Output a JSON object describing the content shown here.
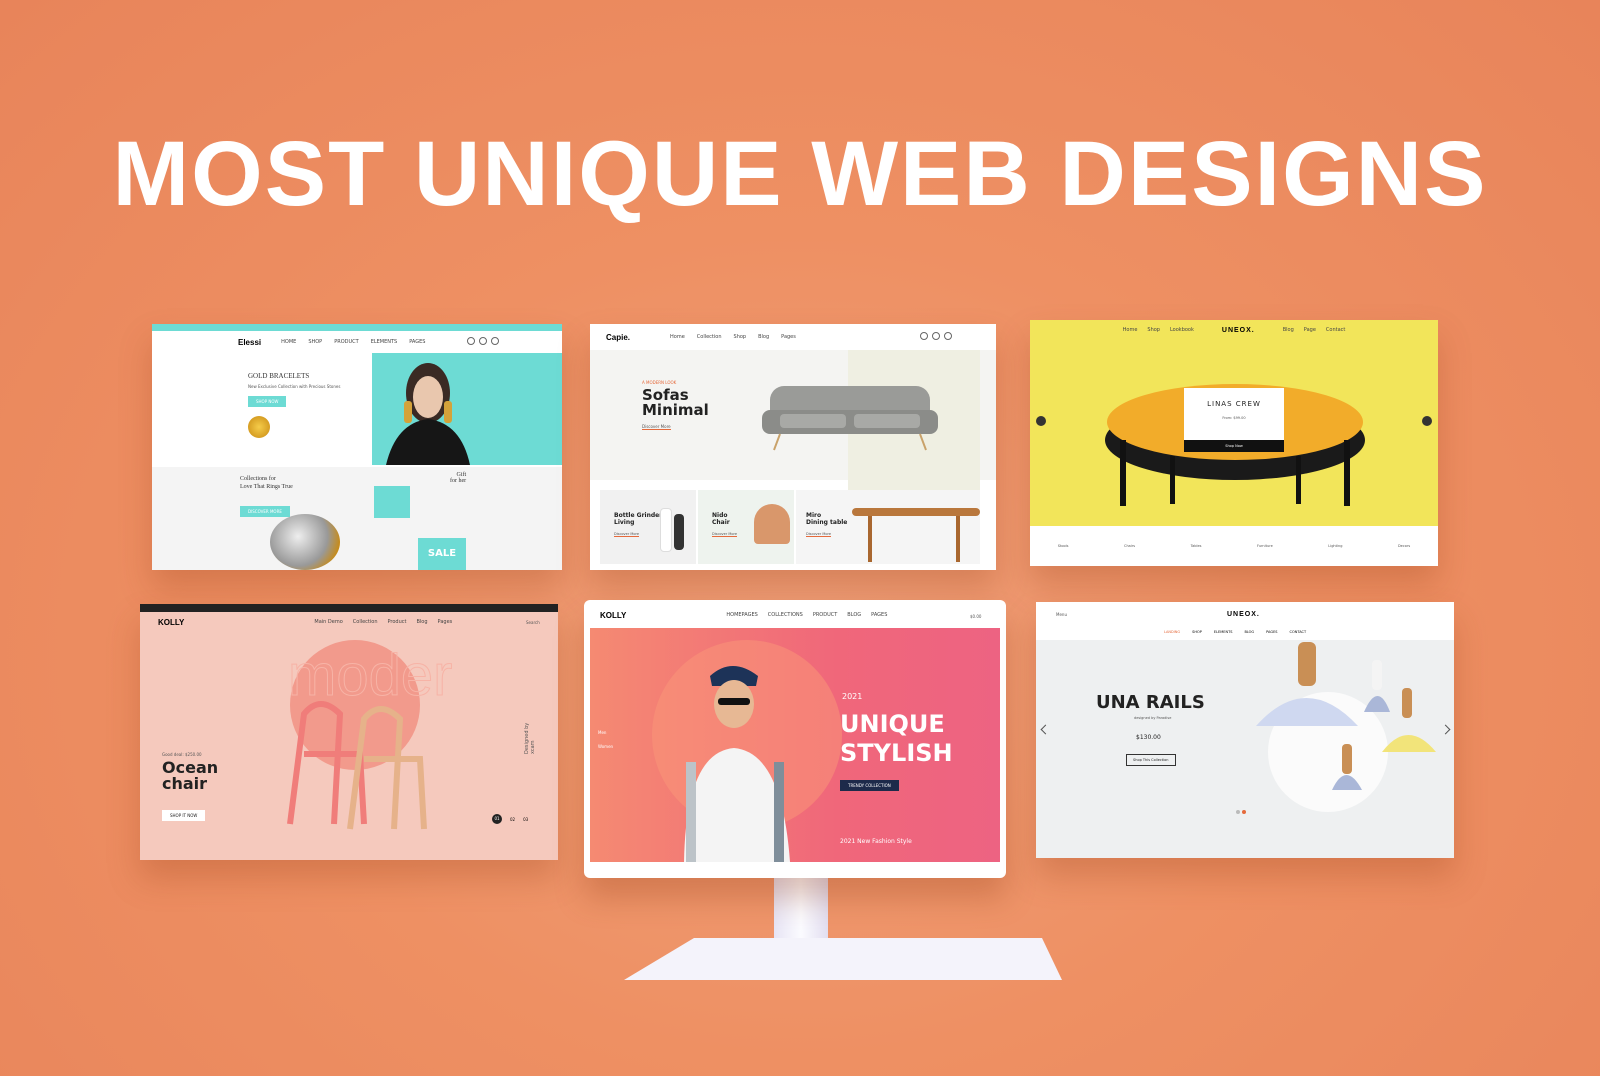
{
  "headline": "MOST UNIQUE WEB DESIGNS",
  "colors": {
    "background": "#ee9063",
    "teal": "#6ddbd4",
    "yellow": "#f2e55a",
    "pink": "#f5c9bd",
    "coral": "#f36f6f",
    "navy": "#1d2a4a"
  },
  "shot1": {
    "logo": "Elessi",
    "nav": [
      "HOME",
      "SHOP",
      "PRODUCT",
      "ELEMENTS",
      "PAGES"
    ],
    "hero_title": "GOLD BRACELETS",
    "hero_sub": "New Exclusive Collection with Precious Stones",
    "hero_btn": "SHOP NOW",
    "promo_title": "Collections for\nLove That Rings True",
    "promo_btn": "DISCOVER MORE",
    "gift_text": "Gift\nfor her",
    "sale": "SALE"
  },
  "shot2": {
    "logo": "Capie.",
    "nav": [
      "Home",
      "Collection",
      "Shop",
      "Blog",
      "Pages"
    ],
    "hero_kicker": "A MODERN LOOK",
    "hero_title": "Sofas\nMinimal",
    "hero_link": "Discover More",
    "tiles": [
      {
        "title": "Bottle Grinder\nLiving",
        "link": "Discover More"
      },
      {
        "title": "Nido\nChair",
        "link": "Discover More"
      },
      {
        "title": "Miro\nDining table",
        "link": "Discover More"
      }
    ]
  },
  "shot3": {
    "logo": "UNEOX.",
    "nav": [
      "Home",
      "Shop",
      "Lookbook",
      "Blog",
      "Page",
      "Contact"
    ],
    "card_title": "LINAS CREW",
    "card_sub": "From: $99.00",
    "card_btn": "Shop Now",
    "categories": [
      "Stools",
      "Chairs",
      "Tables",
      "Furniture",
      "Lighting",
      "Decors"
    ]
  },
  "shot4": {
    "logo": "KOLLY",
    "nav": [
      "Main Demo",
      "Collection",
      "Product",
      "Blog",
      "Pages"
    ],
    "search": "Search",
    "bg_word": "moder",
    "deal": "Good deal: $250.00",
    "title": "Ocean\nchair",
    "btn": "SHOP IT NOW",
    "side": "Designed by xcam",
    "pager": [
      "01",
      "02",
      "03"
    ]
  },
  "shot5": {
    "logo": "KOLLY",
    "nav": [
      "HOMEPAGES",
      "COLLECTIONS",
      "PRODUCT",
      "BLOG",
      "PAGES"
    ],
    "cart": "$0.00",
    "year": "2021",
    "title": "UNIQUE\nSTYLISH",
    "btn": "TRENDY COLLECTION",
    "foot": "2021 New Fashion Style",
    "side": [
      "Men",
      "Women"
    ]
  },
  "shot6": {
    "logo": "UNEOX.",
    "menu": "Menu",
    "nav": [
      "LANDING",
      "SHOP",
      "ELEMENTS",
      "BLOG",
      "PAGES",
      "CONTACT"
    ],
    "title": "UNA RAILS",
    "sub": "designed by Paradise",
    "price": "$130.00",
    "btn": "Shop This Collection"
  }
}
